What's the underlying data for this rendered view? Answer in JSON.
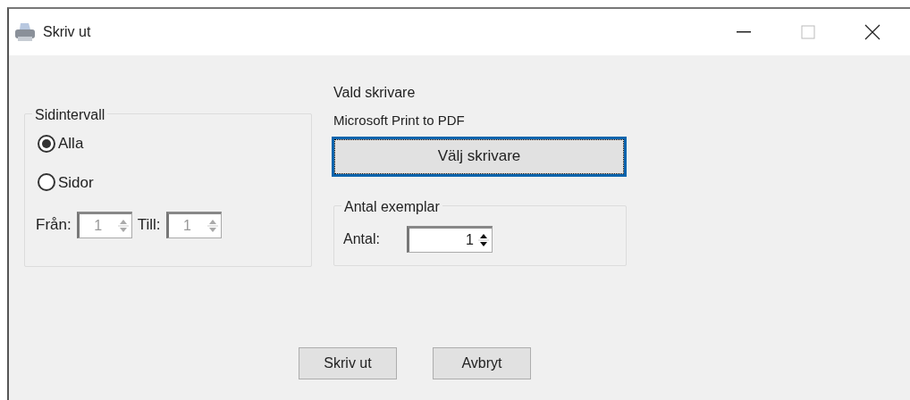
{
  "window": {
    "title": "Skriv ut",
    "maximize_disabled": true
  },
  "page_range": {
    "title": "Sidintervall",
    "options": [
      {
        "label": "Alla",
        "selected": true
      },
      {
        "label": "Sidor",
        "selected": false
      }
    ],
    "spinners": [
      {
        "label": "Från:",
        "value": "1",
        "disabled": true
      },
      {
        "label": "Till:",
        "value": "1",
        "disabled": true
      }
    ]
  },
  "printer": {
    "heading": "Vald skrivare",
    "name": "Microsoft Print to PDF",
    "button": "Välj skrivare"
  },
  "copies": {
    "title": "Antal exemplar",
    "label": "Antal:",
    "value": "1",
    "disabled": false
  },
  "buttons": [
    "Skriv ut",
    "Avbryt"
  ]
}
